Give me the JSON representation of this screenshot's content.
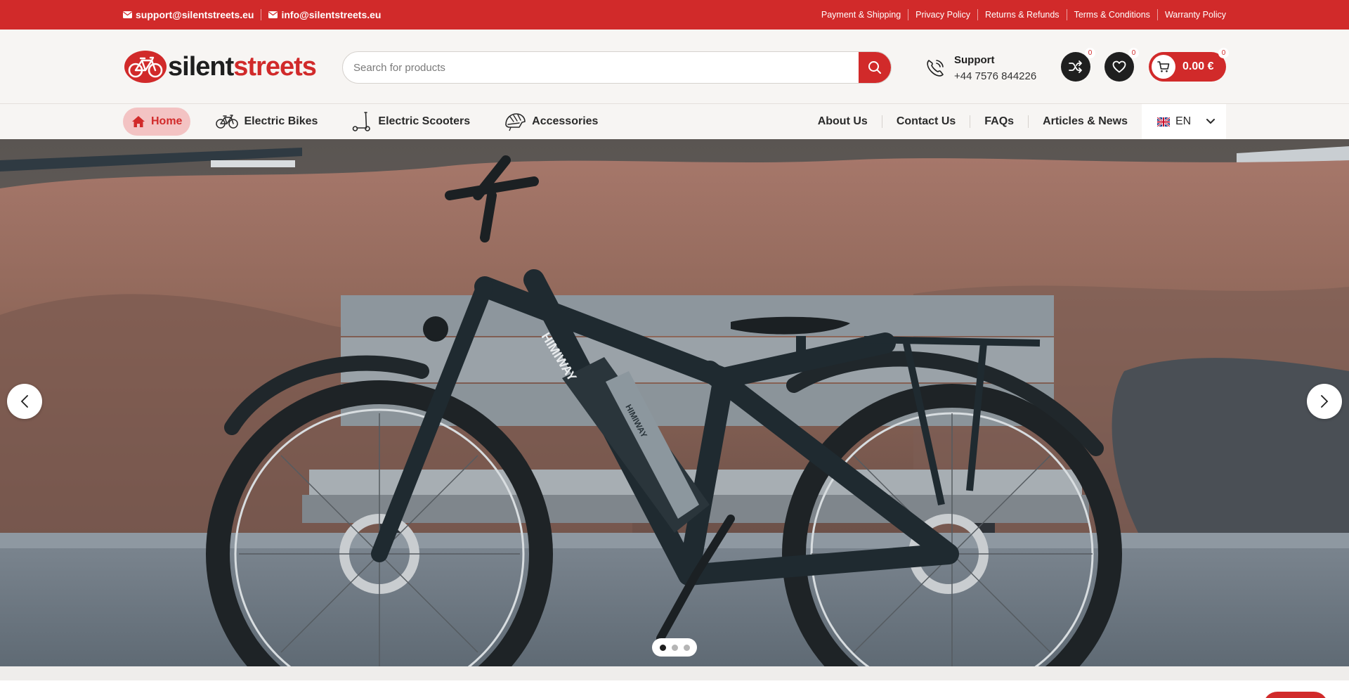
{
  "topbar": {
    "email_support": "support@silentstreets.eu",
    "email_info": "info@silentstreets.eu",
    "links": [
      "Payment & Shipping",
      "Privacy Policy",
      "Returns & Refunds",
      "Terms & Conditions",
      "Warranty Policy"
    ]
  },
  "header": {
    "logo_part1": "silent",
    "logo_part2": "streets",
    "search_placeholder": "Search for products",
    "support_title": "Support",
    "support_phone": "+44 7576 844226",
    "compare_count": "0",
    "wishlist_count": "0",
    "cart_total": "0.00 €",
    "cart_count": "0"
  },
  "nav": {
    "left": [
      "Home",
      "Electric Bikes",
      "Electric Scooters",
      "Accessories"
    ],
    "right": [
      "About Us",
      "Contact Us",
      "FAQs",
      "Articles & News"
    ],
    "language": "EN"
  },
  "hero": {
    "slides": 3,
    "active_slide": 1,
    "frame_text": "HIMIWAY",
    "battery_text": "HIMIWAY"
  },
  "colors": {
    "brand_red": "#d12a2a",
    "dark": "#1f1f1f",
    "page_bg": "#f7f5f3"
  }
}
